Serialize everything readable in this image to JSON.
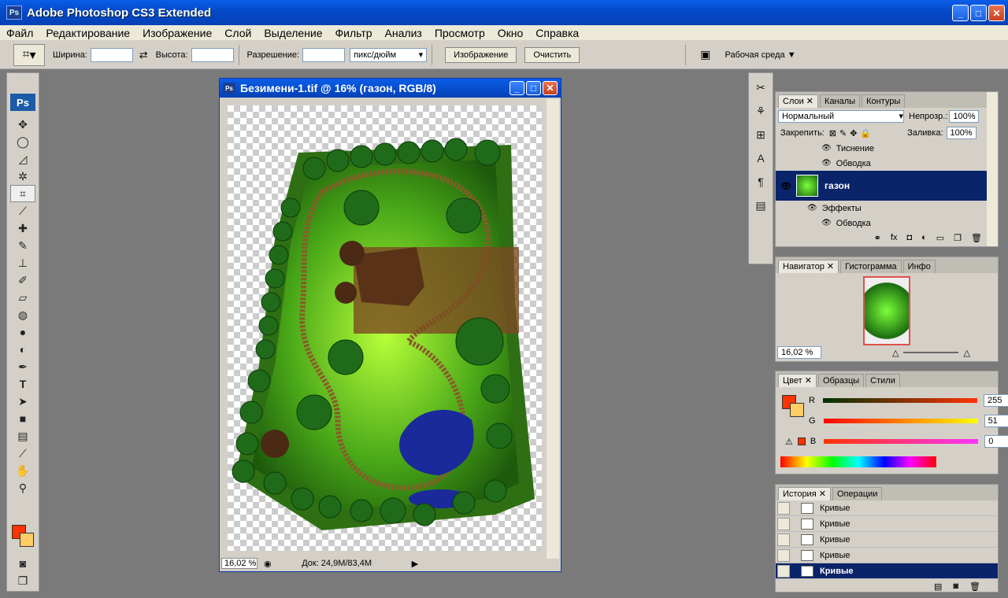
{
  "app": {
    "title": "Adobe Photoshop CS3 Extended",
    "icon_label": "Ps"
  },
  "window_buttons": {
    "minimize": "_",
    "maximize": "□",
    "close": "✕"
  },
  "menu": [
    "Файл",
    "Редактирование",
    "Изображение",
    "Слой",
    "Выделение",
    "Фильтр",
    "Анализ",
    "Просмотр",
    "Окно",
    "Справка"
  ],
  "options": {
    "width_label": "Ширина:",
    "height_label": "Высота:",
    "resolution_label": "Разрешение:",
    "units": "пикс/дюйм",
    "image_button": "Изображение",
    "clear_button": "Очистить",
    "workspace": "Рабочая среда ▼"
  },
  "toolbox": {
    "logo": "Ps"
  },
  "document": {
    "title": "Безимени-1.tif @ 16% (газон, RGB/8)",
    "zoom": "16,02 %",
    "doc_info": "Док: 24,9M/83,4M"
  },
  "layers_panel": {
    "tabs": [
      "Слои",
      "Каналы",
      "Контуры"
    ],
    "blend_mode": "Нормальный",
    "opacity_label": "Непрозр.:",
    "opacity": "100%",
    "lock_label": "Закрепить:",
    "fill_label": "Заливка:",
    "fill": "100%",
    "rows_top": [
      "Тиснение",
      "Обводка"
    ],
    "active_layer": "газон",
    "effects_label": "Эффекты",
    "effect_stroke": "Обводка"
  },
  "navigator_panel": {
    "tabs": [
      "Навигатор",
      "Гистограмма",
      "Инфо"
    ],
    "zoom": "16,02 %"
  },
  "color_panel": {
    "tabs": [
      "Цвет",
      "Образцы",
      "Стили"
    ],
    "channels": [
      {
        "label": "R",
        "value": "255"
      },
      {
        "label": "G",
        "value": "51"
      },
      {
        "label": "B",
        "value": "0"
      }
    ],
    "foreground": "#ff3300",
    "background": "#ffcc66"
  },
  "history_panel": {
    "tabs": [
      "История",
      "Операции"
    ],
    "items": [
      "Кривые",
      "Кривые",
      "Кривые",
      "Кривые"
    ],
    "active_item": "Кривые"
  }
}
